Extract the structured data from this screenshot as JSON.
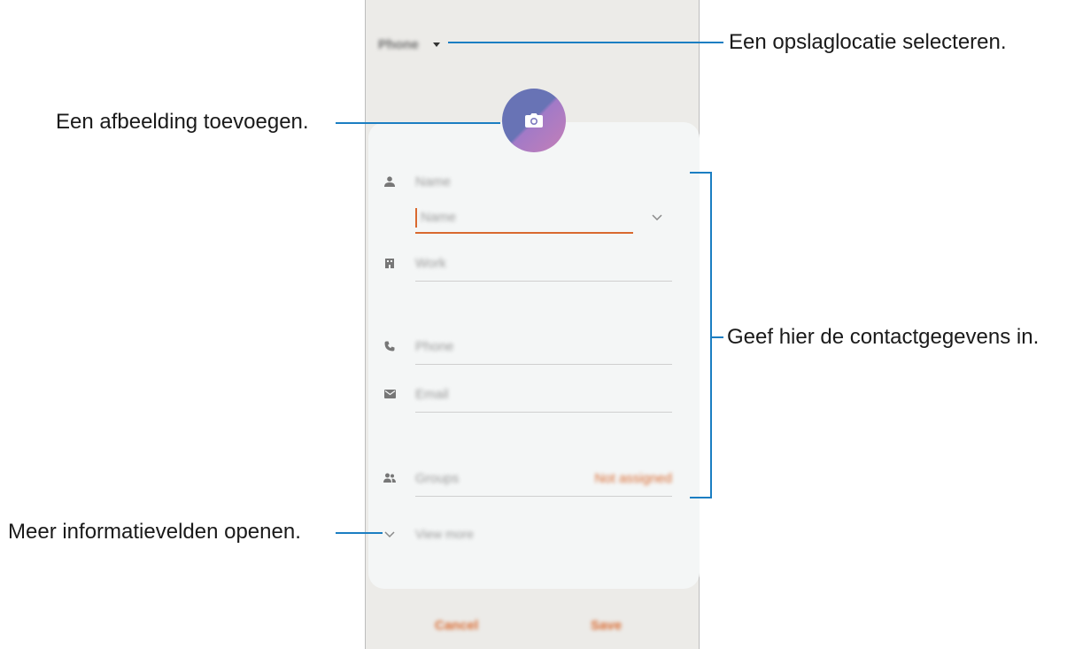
{
  "phone": {
    "storage_label": "Phone",
    "fields": {
      "name_label": "Name",
      "name_placeholder": "Name",
      "work_label": "Work",
      "phone_label": "Phone",
      "email_label": "Email",
      "groups_label": "Groups",
      "groups_value": "Not assigned"
    },
    "view_more": "View more",
    "cancel_label": "Cancel",
    "save_label": "Save"
  },
  "annotations": {
    "storage": "Een opslaglocatie selecteren.",
    "image": "Een afbeelding toevoegen.",
    "contact_info": "Geef hier de contactgegevens in.",
    "more_fields": "Meer informatievelden openen."
  },
  "colors": {
    "accent": "#d9692f",
    "callout_line": "#1b7ec2",
    "screen_bg": "#ecebe8",
    "card_bg": "#f4f6f6"
  },
  "icons": [
    "camera-icon",
    "person-icon",
    "building-icon",
    "phone-icon",
    "email-icon",
    "group-icon",
    "chevron-down-icon"
  ]
}
